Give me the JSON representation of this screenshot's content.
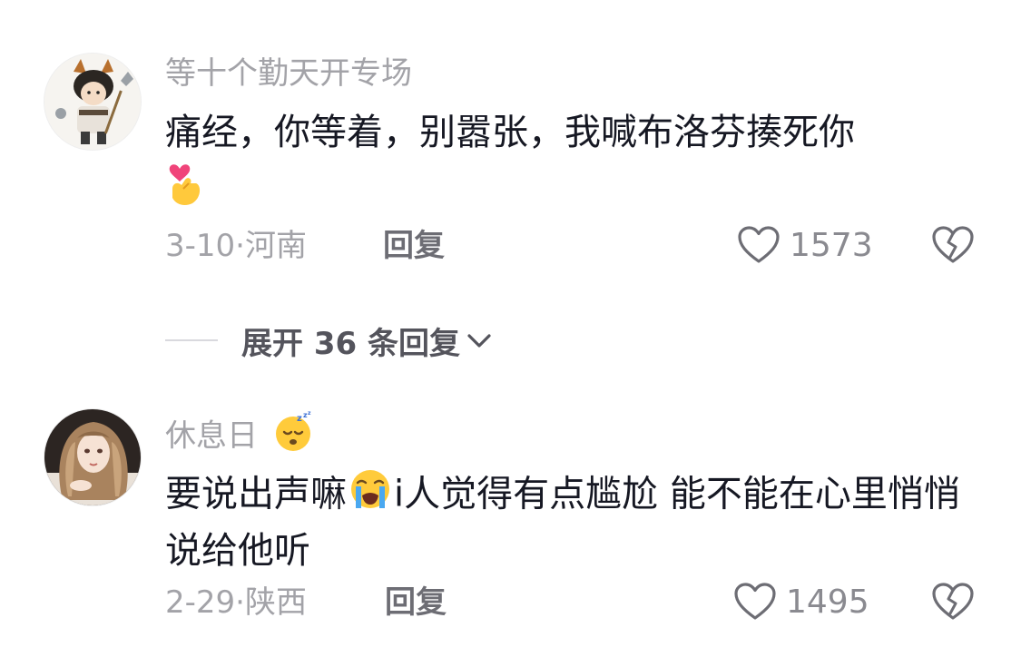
{
  "comments": [
    {
      "username": "等十个勤天开专场",
      "text": "痛经，你等着，别嚣张，我喊布洛芬揍死你",
      "text_emoji": "finger-heart-emoji",
      "date": "3-10",
      "separator": "·",
      "location": "河南",
      "reply_label": "回复",
      "likes": "1573",
      "avatar_icon": "cartoon-boy-avatar"
    },
    {
      "username": "休息日",
      "username_emoji": "sleeping-face-emoji",
      "text_part1": "要说出声嘛",
      "text_emoji": "loudly-crying-face-emoji",
      "text_part2": "i人觉得有点尴尬 能不能在心里悄悄说给他听",
      "date": "2-29",
      "separator": "·",
      "location": "陕西",
      "reply_label": "回复",
      "likes": "1495",
      "avatar_icon": "anime-girl-avatar"
    }
  ],
  "expand_replies": {
    "label": "展开 36 条回复"
  },
  "colors": {
    "text": "#161823",
    "secondary": "#a3a3a8",
    "reply": "#6d6d74"
  }
}
